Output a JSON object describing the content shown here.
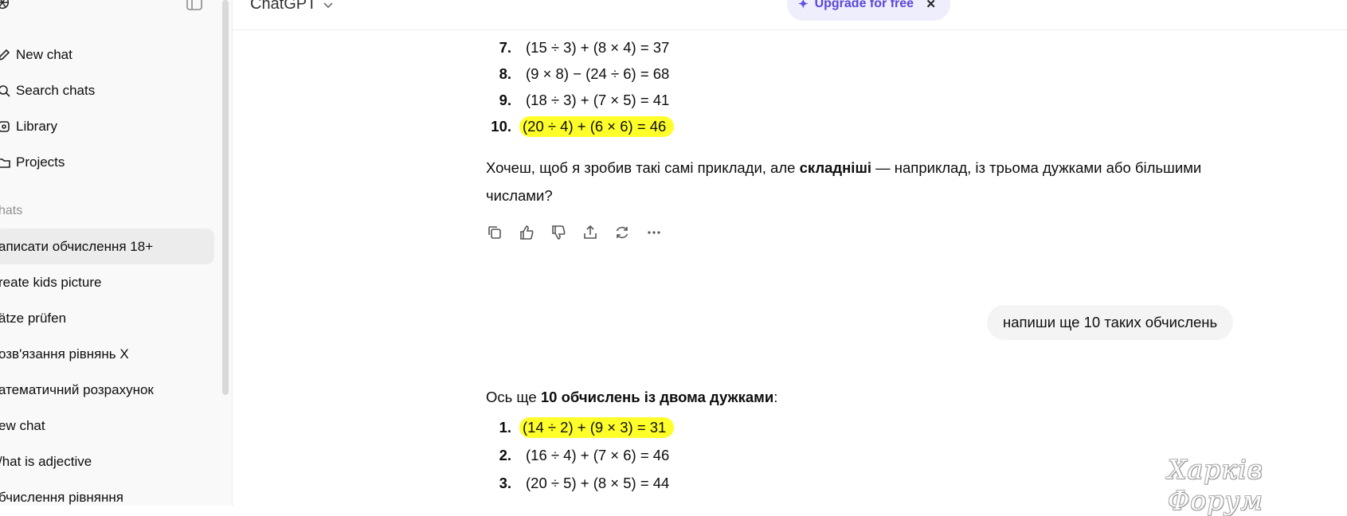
{
  "header": {
    "model_name": "ChatGPT",
    "upgrade_label": "Upgrade for free"
  },
  "sidebar": {
    "nav": [
      {
        "label": "New chat"
      },
      {
        "label": "Search chats"
      },
      {
        "label": "Library"
      },
      {
        "label": "Projects"
      }
    ],
    "section_label": "hats",
    "chats": [
      {
        "label": "аписати обчислення 18+"
      },
      {
        "label": "reate kids picture"
      },
      {
        "label": "ätze prüfen"
      },
      {
        "label": "озв'язання рівнянь X"
      },
      {
        "label": "атематичний розрахунок"
      },
      {
        "label": "ew chat"
      },
      {
        "label": "/hat is adjective"
      },
      {
        "label": "бчислення рівняння"
      }
    ]
  },
  "conversation": {
    "list1": [
      {
        "num": "7.",
        "expr": "(15 ÷ 3) + (8 × 4) = 37"
      },
      {
        "num": "8.",
        "expr": "(9 × 8) − (24 ÷ 6) = 68"
      },
      {
        "num": "9.",
        "expr": "(18 ÷ 3) + (7 × 5) = 41"
      },
      {
        "num": "10.",
        "expr": "(20 ÷ 4) + (6 × 6) = 46"
      }
    ],
    "followup": {
      "part1": "Хочеш, щоб я зробив такі самі приклади, але ",
      "bold": "складніші",
      "part2": " — наприклад, із трьома дужками або більшими числами?"
    },
    "user_message": "напиши ще 10 таких обчислень",
    "intro": {
      "part1": "Ось ще ",
      "bold": "10 обчислень із двома дужками",
      "part2": ":"
    },
    "list2": [
      {
        "num": "1.",
        "expr": "(14 ÷ 2) + (9 × 3) = 31"
      },
      {
        "num": "2.",
        "expr": "(16 ÷ 4) + (7 × 6) = 46"
      },
      {
        "num": "3.",
        "expr": "(20 ÷ 5) + (8 × 5) = 44"
      }
    ]
  },
  "watermark": "Харків Форум",
  "colors": {
    "highlight": "#ffff2a",
    "upgrade_bg": "#eeeefd",
    "upgrade_text": "#5a48d8"
  }
}
